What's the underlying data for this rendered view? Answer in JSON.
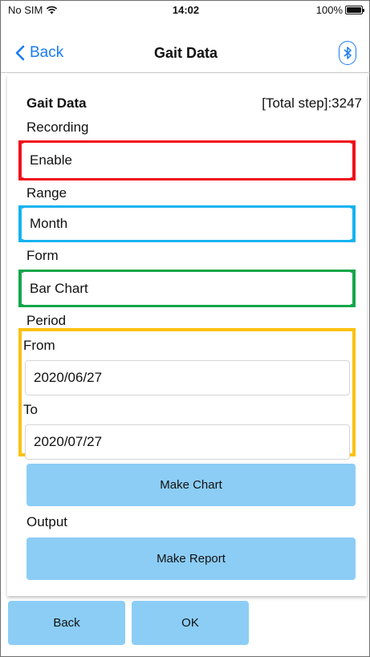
{
  "status_bar": {
    "carrier": "No SIM",
    "wifi_icon": "wifi-icon",
    "time": "14:02",
    "battery_percent": "100%"
  },
  "nav": {
    "back_label": "Back",
    "title": "Gait Data",
    "bluetooth_icon": "bluetooth-icon"
  },
  "form": {
    "section_title": "Gait Data",
    "total_step": "[Total step]:3247",
    "recording_label": "Recording",
    "recording_value": "Enable",
    "range_label": "Range",
    "range_value": "Month",
    "form_label": "Form",
    "form_value": "Bar Chart",
    "period_label": "Period",
    "from_label": "From",
    "from_value": "2020/06/27",
    "to_label": "To",
    "to_value": "2020/07/27",
    "make_chart_label": "Make Chart",
    "output_label": "Output",
    "make_report_label": "Make Report"
  },
  "toolbar": {
    "back_label": "Back",
    "ok_label": "OK"
  },
  "colors": {
    "accent": "#1a7cf5",
    "button_fill": "#8ccdf6",
    "highlight_red": "#f0101a",
    "highlight_blue": "#16b3ef",
    "highlight_green": "#14a64a",
    "highlight_yellow": "#fcc10e"
  }
}
